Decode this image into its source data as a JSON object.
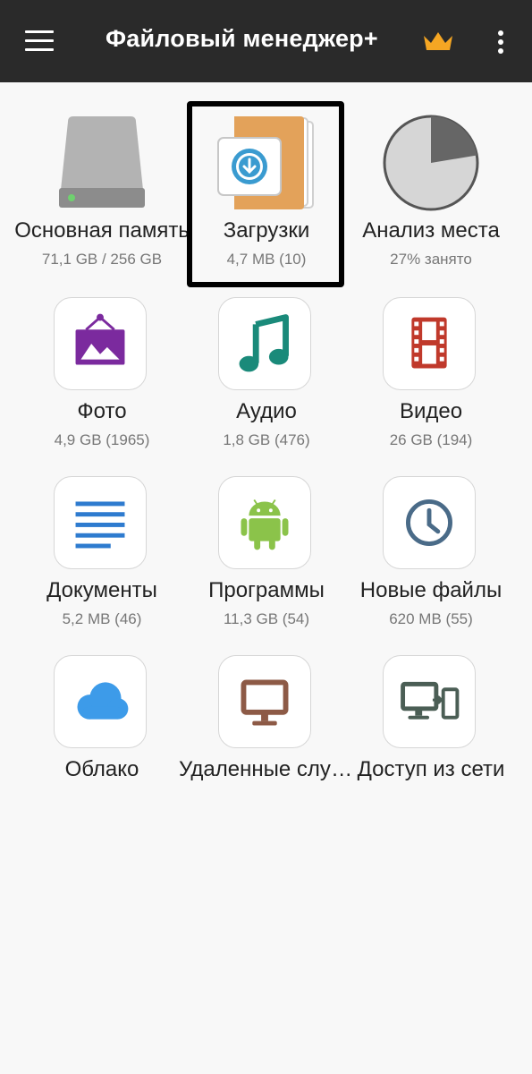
{
  "app_bar": {
    "title": "Файловый менеджер+",
    "menu_icon": "hamburger-menu-icon",
    "premium_icon": "crown-icon",
    "more_icon": "more-vertical-icon",
    "background_color": "#2a2a2a",
    "crown_color": "#f5a623"
  },
  "tiles": [
    {
      "id": "main-storage",
      "label": "Основная память",
      "sub": "71,1 GB / 256 GB",
      "icon": "hard-drive-icon"
    },
    {
      "id": "downloads",
      "label": "Загрузки",
      "sub": "4,7 MB (10)",
      "icon": "download-folder-icon",
      "selected": true
    },
    {
      "id": "space-analysis",
      "label": "Анализ места",
      "sub": "27% занято",
      "icon": "pie-chart-icon",
      "used_fraction": 0.27
    },
    {
      "id": "photo",
      "label": "Фото",
      "sub": "4,9 GB (1965)",
      "icon": "picture-icon",
      "color": "#7b2a9e"
    },
    {
      "id": "audio",
      "label": "Аудио",
      "sub": "1,8 GB (476)",
      "icon": "music-note-icon",
      "color": "#1a8a7a"
    },
    {
      "id": "video",
      "label": "Видео",
      "sub": "26 GB (194)",
      "icon": "film-strip-icon",
      "color": "#c0392b"
    },
    {
      "id": "documents",
      "label": "Документы",
      "sub": "5,2 MB (46)",
      "icon": "document-lines-icon",
      "color": "#2e7bcf"
    },
    {
      "id": "apps",
      "label": "Программы",
      "sub": "11,3 GB (54)",
      "icon": "android-icon",
      "color": "#8bc34a"
    },
    {
      "id": "new-files",
      "label": "Новые файлы",
      "sub": "620 MB (55)",
      "icon": "clock-icon",
      "color": "#4a6b88"
    },
    {
      "id": "cloud",
      "label": "Облако",
      "sub": "",
      "icon": "cloud-icon",
      "color": "#3d9be9"
    },
    {
      "id": "remote",
      "label": "Удаленные службы",
      "sub": "",
      "icon": "monitor-icon",
      "color": "#8d5a46"
    },
    {
      "id": "network-access",
      "label": "Доступ из сети",
      "sub": "",
      "icon": "pc-to-phone-icon",
      "color": "#4b5e55"
    }
  ]
}
